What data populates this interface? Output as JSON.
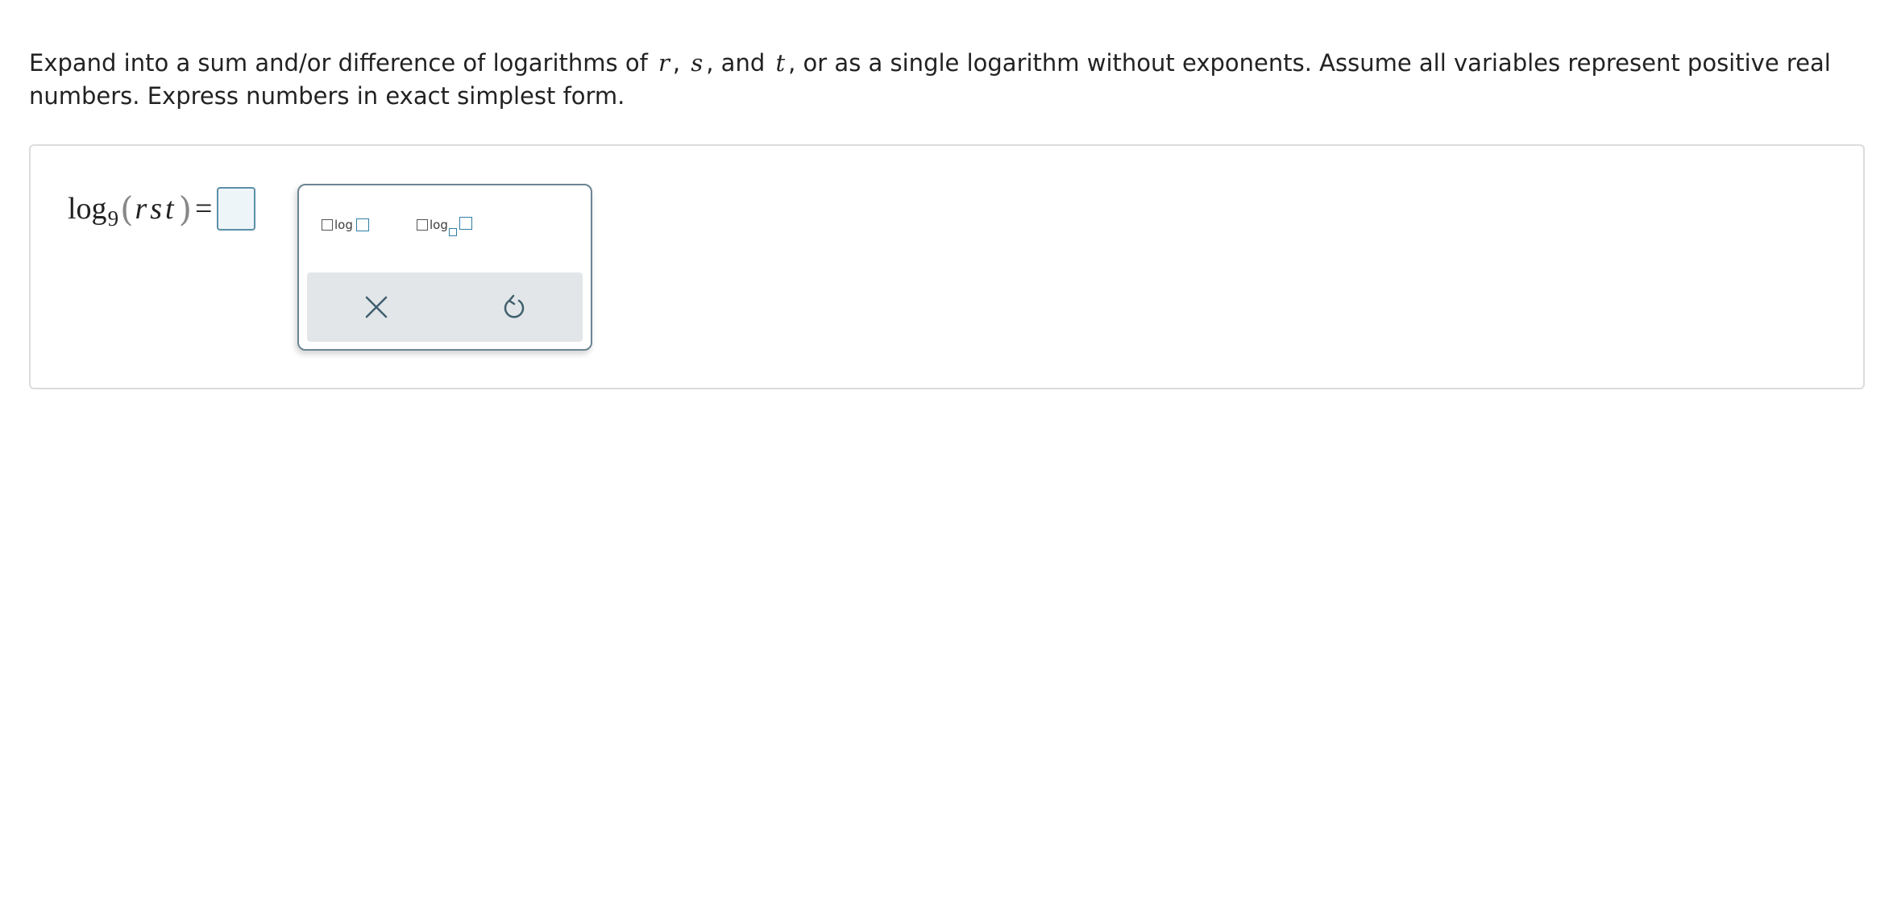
{
  "question": {
    "text_before_r": "Expand into a sum and/or difference of logarithms of",
    "var_r": "r",
    "sep1": ",",
    "var_s": "s",
    "sep2": ", and",
    "var_t": "t",
    "text_after_t": ", or as a single logarithm without exponents. Assume all variables represent positive real numbers. Express numbers in exact simplest form."
  },
  "equation": {
    "log_word": "log",
    "base": "9",
    "open_paren": "(",
    "argument": "rst",
    "close_paren": ")",
    "equals": "="
  },
  "answer": {
    "value": ""
  },
  "palette": {
    "tools": [
      {
        "name": "coefficient-log",
        "label": "log"
      },
      {
        "name": "coefficient-log-base",
        "label": "log"
      }
    ],
    "actions": [
      {
        "name": "clear",
        "icon": "close-icon"
      },
      {
        "name": "undo",
        "icon": "undo-icon"
      }
    ]
  },
  "colors": {
    "accent": "#2f7fa4",
    "panel_border": "#dcdcdc",
    "palette_border": "#6b8592",
    "action_bar": "#e2e6e8",
    "icon": "#3f5f6e"
  }
}
